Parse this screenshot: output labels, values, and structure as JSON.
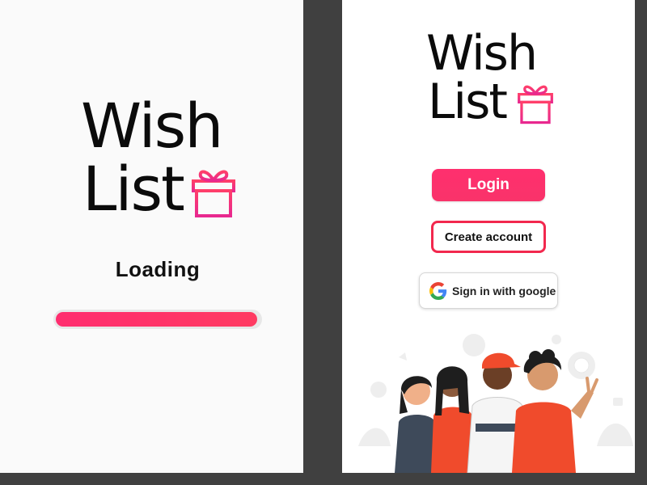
{
  "logo": {
    "line1": "Wish",
    "line2": "List",
    "icon": "gift-icon"
  },
  "loading_screen": {
    "status_text": "Loading",
    "progress": 0.99,
    "colors": {
      "accent": "#ff2d6f",
      "track": "#e7e7e7"
    }
  },
  "login_screen": {
    "login_label": "Login",
    "create_account_label": "Create account",
    "google_label": "Sign in with google",
    "google_icon": "google-g-icon",
    "illustration": "group-of-friends-illustration"
  },
  "colors": {
    "brand_pink": "#ff2d6f",
    "brand_red": "#f2284e",
    "text": "#111111"
  }
}
